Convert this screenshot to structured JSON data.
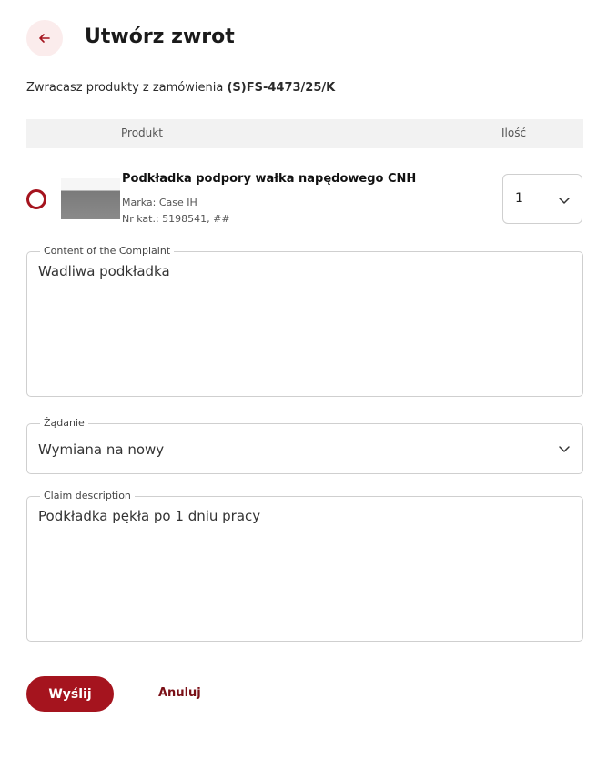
{
  "header": {
    "back_icon": "arrow-left-icon",
    "title": "Utwórz zwrot"
  },
  "order": {
    "prefix": "Zwracasz produkty z zamówienia",
    "number": "(S)FS-4473/25/K"
  },
  "table": {
    "col_product": "Produkt",
    "col_qty": "Ilość"
  },
  "product": {
    "name": "Podkładka podpory wałka napędowego CNH",
    "brand": "Marka: Case IH",
    "catalog": "Nr kat.: 5198541, ##",
    "quantity": "1"
  },
  "form": {
    "complaint_label": "Content of the Complaint",
    "complaint_value": "Wadliwa podkładka",
    "request_label": "Żądanie",
    "request_value": "Wymiana na nowy",
    "claim_label": "Claim description",
    "claim_value": "Podkładka pękła po 1 dniu pracy"
  },
  "actions": {
    "send": "Wyślij",
    "cancel": "Anuluj"
  },
  "colors": {
    "accent": "#a5141e",
    "accent_light": "#fbecec"
  }
}
